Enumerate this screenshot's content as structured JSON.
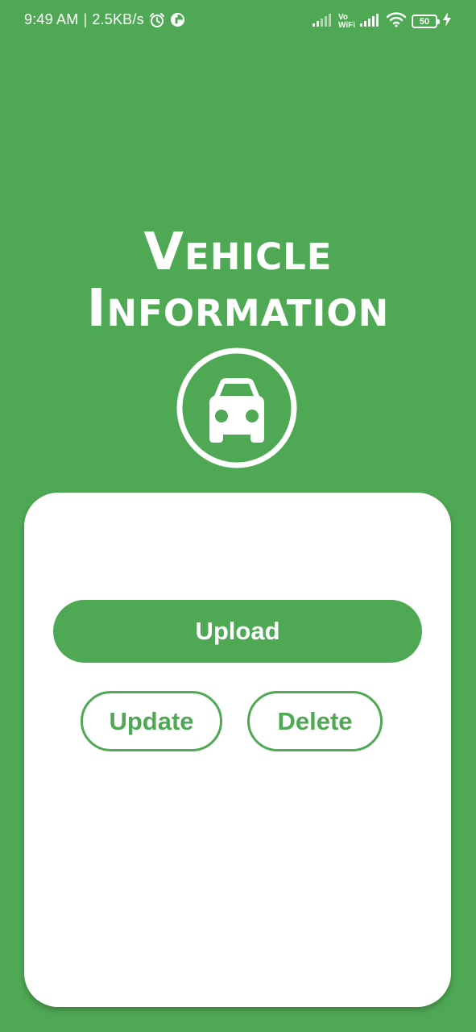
{
  "status_bar": {
    "time": "9:49 AM",
    "separator": "|",
    "speed": "2.5KB/s",
    "vo_wifi_top": "Vo",
    "vo_wifi_bottom": "WiFi",
    "battery_level": "50",
    "icons": [
      "alarm-icon",
      "app-notification-icon",
      "signal-icon",
      "vowifi-icon",
      "signal-icon",
      "wifi-icon",
      "battery-icon",
      "charging-icon"
    ]
  },
  "header": {
    "title_line1": "Vehicle",
    "title_line2": "Information",
    "logo_icon": "car-icon"
  },
  "actions": {
    "upload_label": "Upload",
    "update_label": "Update",
    "delete_label": "Delete"
  },
  "colors": {
    "background": "#4FA954",
    "card": "#FFFFFF",
    "accent": "#4FA954"
  }
}
